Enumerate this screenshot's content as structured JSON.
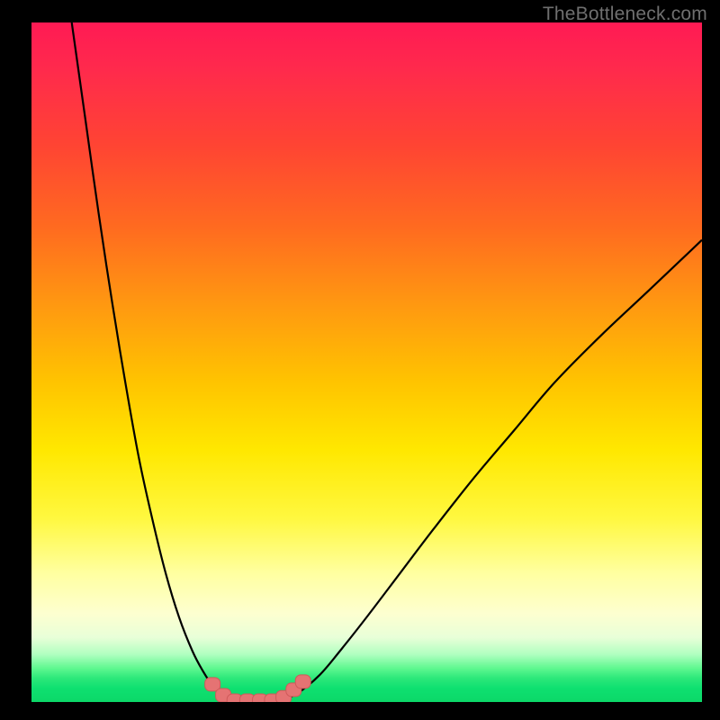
{
  "watermark": "TheBottleneck.com",
  "colors": {
    "frame": "#000000",
    "curve": "#000000",
    "marker_fill": "#e57373",
    "marker_stroke": "#cf5a5a"
  },
  "chart_data": {
    "type": "line",
    "title": "",
    "xlabel": "",
    "ylabel": "",
    "xlim": [
      0,
      100
    ],
    "ylim": [
      0,
      100
    ],
    "grid": false,
    "legend": false,
    "annotations": [
      "TheBottleneck.com"
    ],
    "note": "Axes are unlabeled in the image; x/y values are estimated from pixel positions on a 0-100 normalized scale.",
    "series": [
      {
        "name": "curve-left",
        "x": [
          6.0,
          8.0,
          10.0,
          12.0,
          14.0,
          16.0,
          18.0,
          20.0,
          22.0,
          24.0,
          25.6,
          27.1,
          28.7,
          30.0
        ],
        "y": [
          100.0,
          86.0,
          72.0,
          59.0,
          47.0,
          36.0,
          27.0,
          19.0,
          12.5,
          7.5,
          4.5,
          2.3,
          0.9,
          0.1
        ]
      },
      {
        "name": "curve-floor",
        "x": [
          30.0,
          31.5,
          33.0,
          34.5,
          36.0,
          37.4
        ],
        "y": [
          0.1,
          0.05,
          0.03,
          0.05,
          0.08,
          0.15
        ]
      },
      {
        "name": "curve-right",
        "x": [
          37.4,
          40.0,
          43.0,
          46.0,
          50.0,
          55.0,
          60.0,
          66.0,
          72.0,
          78.0,
          85.0,
          92.0,
          100.0
        ],
        "y": [
          0.15,
          1.5,
          4.0,
          7.5,
          12.5,
          19.0,
          25.5,
          33.0,
          40.0,
          47.0,
          54.0,
          60.5,
          68.0
        ]
      }
    ],
    "markers": {
      "name": "highlight-points",
      "shape": "rounded",
      "color": "#e57373",
      "points": [
        {
          "x": 27.0,
          "y": 2.6
        },
        {
          "x": 28.6,
          "y": 1.0
        },
        {
          "x": 30.3,
          "y": 0.2
        },
        {
          "x": 32.2,
          "y": 0.2
        },
        {
          "x": 34.1,
          "y": 0.2
        },
        {
          "x": 35.9,
          "y": 0.2
        },
        {
          "x": 37.6,
          "y": 0.7
        },
        {
          "x": 39.1,
          "y": 1.8
        },
        {
          "x": 40.5,
          "y": 3.0
        }
      ]
    }
  }
}
